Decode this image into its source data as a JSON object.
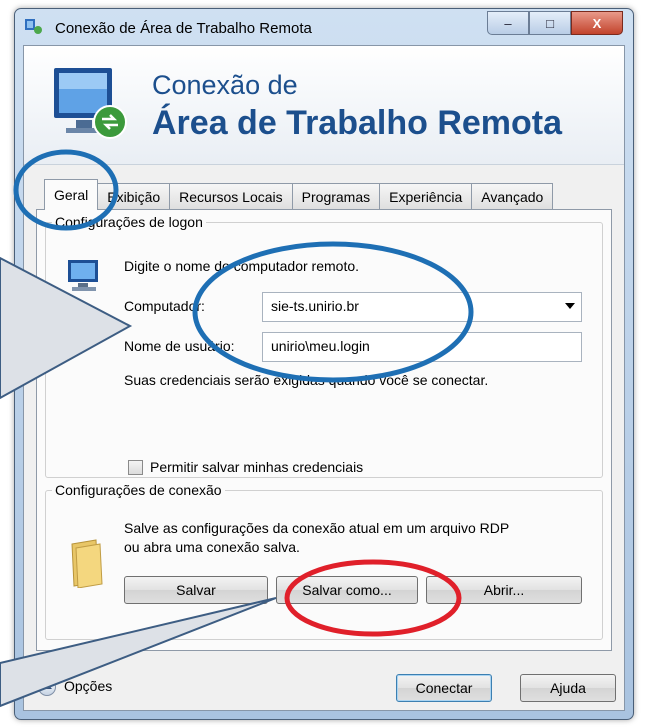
{
  "window": {
    "title": "Conexão de Área de Trabalho Remota",
    "buttons": {
      "minimize": "–",
      "maximize": "□",
      "close": "X"
    }
  },
  "header": {
    "line1": "Conexão de",
    "line2": "Área de Trabalho Remota"
  },
  "tabs": [
    "Geral",
    "Exibição",
    "Recursos Locais",
    "Programas",
    "Experiência",
    "Avançado"
  ],
  "logon": {
    "group_title": "Configurações de logon",
    "instruction": "Digite o nome do computador remoto.",
    "computer_label": "Computador:",
    "computer_value": "sie-ts.unirio.br",
    "username_label": "Nome de usuário:",
    "username_value": "unirio\\meu.login",
    "credentials_note": "Suas credenciais serão exigidas quando você se conectar.",
    "save_credentials_label": "Permitir salvar minhas credenciais",
    "save_credentials_checked": false
  },
  "connection": {
    "group_title": "Configurações de conexão",
    "description_line1": "Salve as configurações da conexão atual em um arquivo RDP",
    "description_line2": "ou abra uma conexão salva.",
    "save_button": "Salvar",
    "save_as_button": "Salvar como...",
    "open_button": "Abrir..."
  },
  "footer": {
    "options_label": "Opções",
    "connect_button": "Conectar",
    "help_button": "Ajuda"
  },
  "icons": {
    "title": "remote-desktop-icon",
    "header": "remote-desktop-icon",
    "logon": "computer-icon",
    "connection": "folder-icon"
  },
  "colors": {
    "header_text": "#1c4f8d",
    "blue_annotation": "#1e6fb4",
    "red_annotation": "#e0202a",
    "callout_fill": "#dde1e7"
  }
}
